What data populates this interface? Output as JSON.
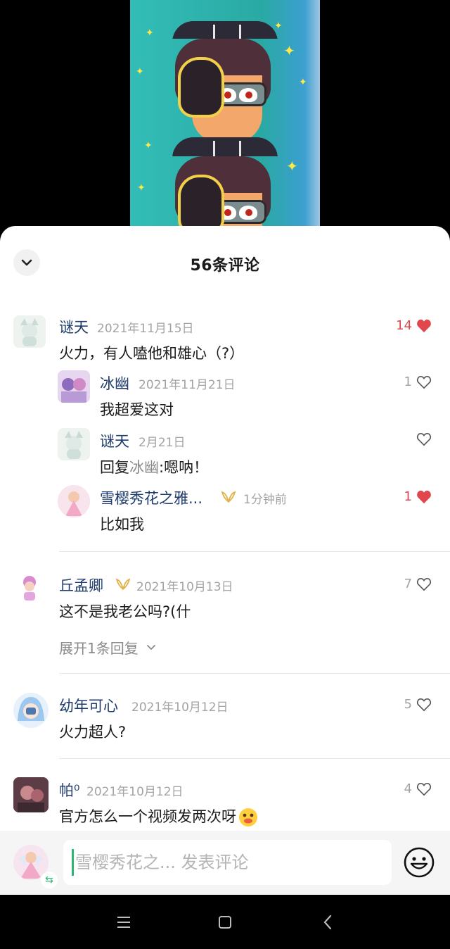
{
  "sheet": {
    "title": "56条评论"
  },
  "comments": [
    {
      "user": "谜天",
      "date": "2021年11月15日",
      "text": "火力，有人嗑他和雄心（?）",
      "likes": "14",
      "liked": true
    },
    {
      "user": "冰幽",
      "date": "2021年11月21日",
      "text": "我超爱这对",
      "likes": "1",
      "liked": false
    },
    {
      "user": "谜天",
      "date": "2月21日",
      "text_prefix": "回复",
      "reply_to": "冰幽",
      "text": ":嗯呐！",
      "likes": "",
      "liked": false
    },
    {
      "user": "雪樱秀花之雅...",
      "date": "1分钟前",
      "text": "比如我",
      "likes": "1",
      "liked": true
    },
    {
      "user": "丘孟卿",
      "date": "2021年10月13日",
      "text": "这不是我老公吗?(什",
      "likes": "7",
      "liked": false,
      "expand_label": "展开1条回复"
    },
    {
      "user": "幼年可心",
      "date": "2021年10月12日",
      "text": "火力超人?",
      "likes": "5",
      "liked": false
    },
    {
      "user": "帕⁰",
      "date": "2021年10月12日",
      "text": "官方怎么一个视频发两次呀",
      "likes": "4",
      "liked": false
    }
  ],
  "input": {
    "placeholder": "雪樱秀花之... 发表评论"
  },
  "colors": {
    "like_red": "#e0474c",
    "username_blue": "#1f3b6b",
    "badge_gold": "#e0b44a"
  }
}
